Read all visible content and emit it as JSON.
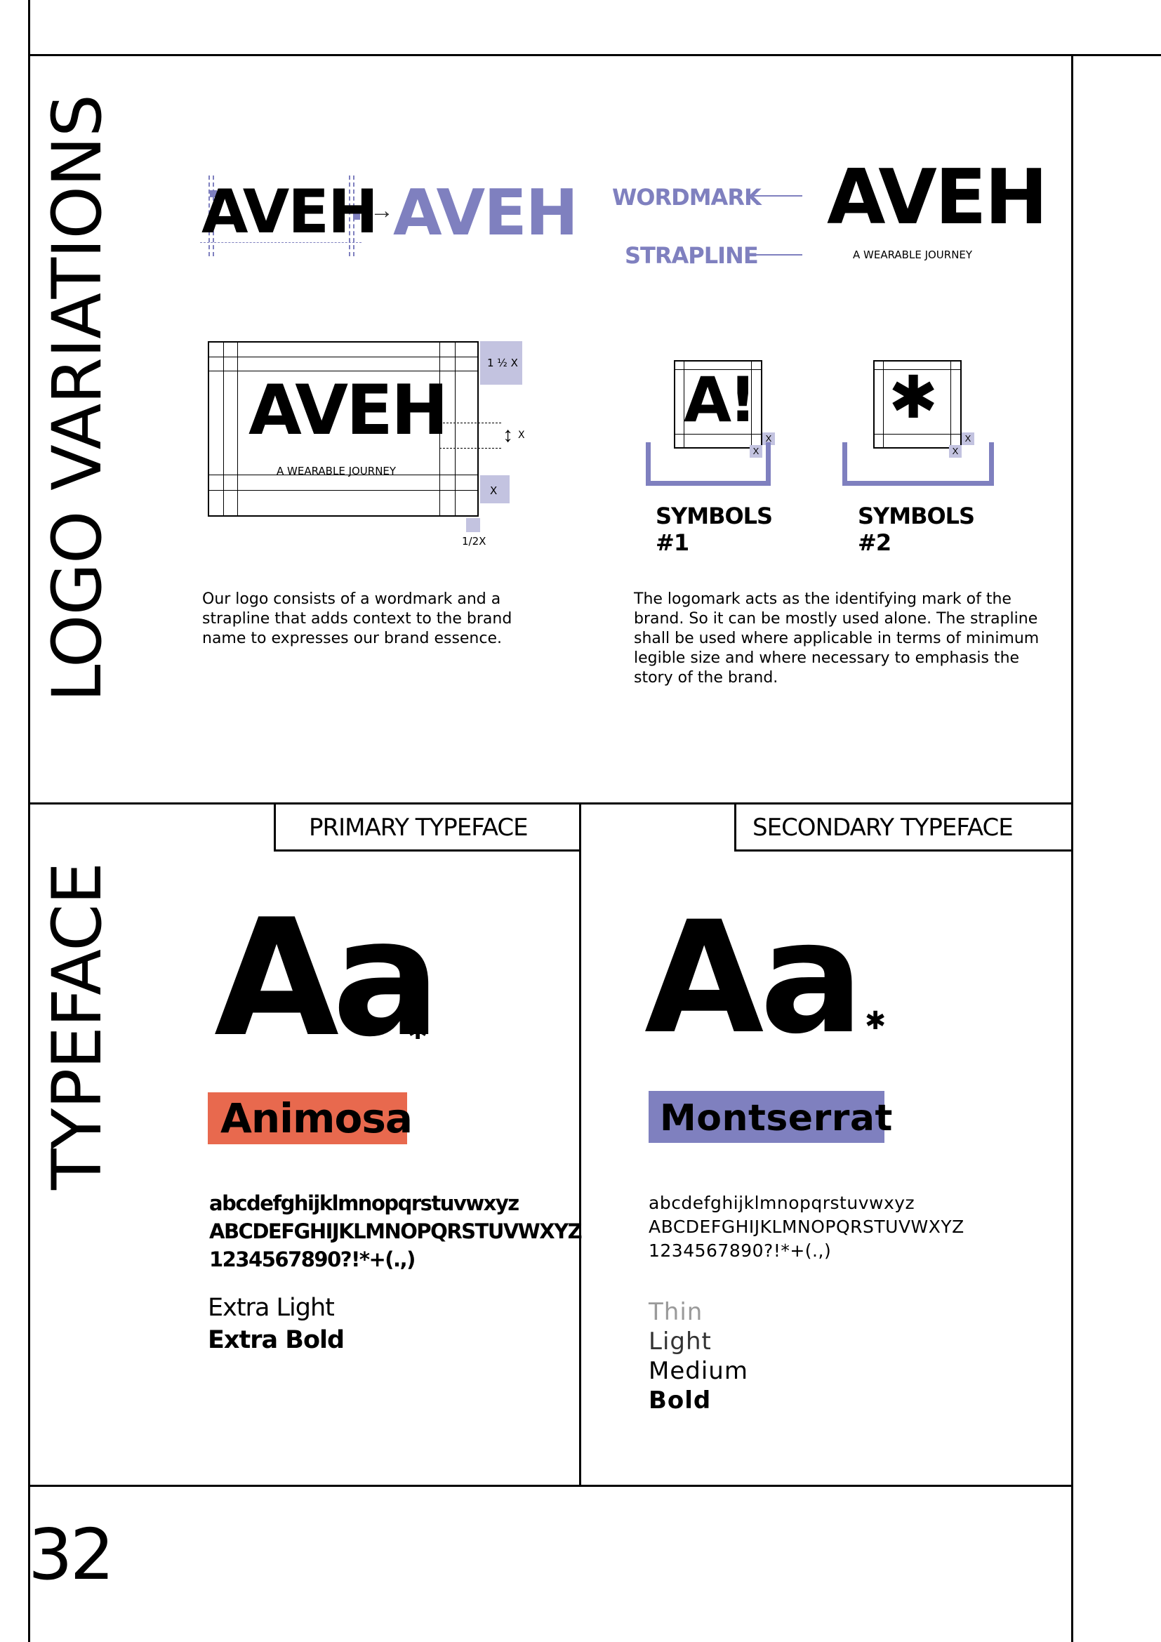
{
  "colors": {
    "ink": "#000000",
    "accent_purple": "#7f80bf",
    "light_purple": "#c3c3e0",
    "accent_orange": "#e8694e",
    "thin_gray": "#9a9a9a"
  },
  "logo_section": {
    "title": "LOGO VARIATIONS",
    "logo_text": "AVEH",
    "labels": {
      "wordmark": "WORDMARK",
      "strapline": "STRAPLINE"
    },
    "strapline_text": "A WEARABLE JOURNEY",
    "measure": {
      "one_half_x": "1 ½ X",
      "x": "X",
      "half_x": "1/2X"
    },
    "symbol1": {
      "glyph": "A!",
      "label": "SYMBOLS #1"
    },
    "symbol2": {
      "glyph": "✱",
      "label": "SYMBOLS #2"
    },
    "description_left": "Our logo consists of a wordmark and a strapline  that adds context to the brand name to expresses our brand essence.",
    "description_right": "The logomark acts as the identifying mark of the brand. So it can be mostly used alone. The strapline shall be used where applicable in terms of minimum legible size and where necessary to emphasis the story of the brand."
  },
  "typeface_section": {
    "title": "TYPEFACE",
    "primary": {
      "tab_label": "PRIMARY TYPEFACE",
      "specimen": "Aa",
      "mark": "✱",
      "name": "Animosa",
      "lowercase": "abcdefghijklmnopqrstuvwxyz",
      "uppercase": "ABCDEFGHIJKLMNOPQRSTUVWXYZ",
      "numbers": "1234567890?!*+(.,)",
      "weights": [
        "Extra Light",
        "Extra Bold"
      ]
    },
    "secondary": {
      "tab_label": "SECONDARY TYPEFACE",
      "specimen": "Aa",
      "mark": "✱",
      "name": "Montserrat",
      "lowercase": "abcdefghijklmnopqrstuvwxyz",
      "uppercase": "ABCDEFGHIJKLMNOPQRSTUVWXYZ",
      "numbers": "1234567890?!*+(.,)",
      "weights": [
        "Thin",
        "Light",
        "Medium",
        "Bold"
      ]
    }
  },
  "page_number": "32"
}
